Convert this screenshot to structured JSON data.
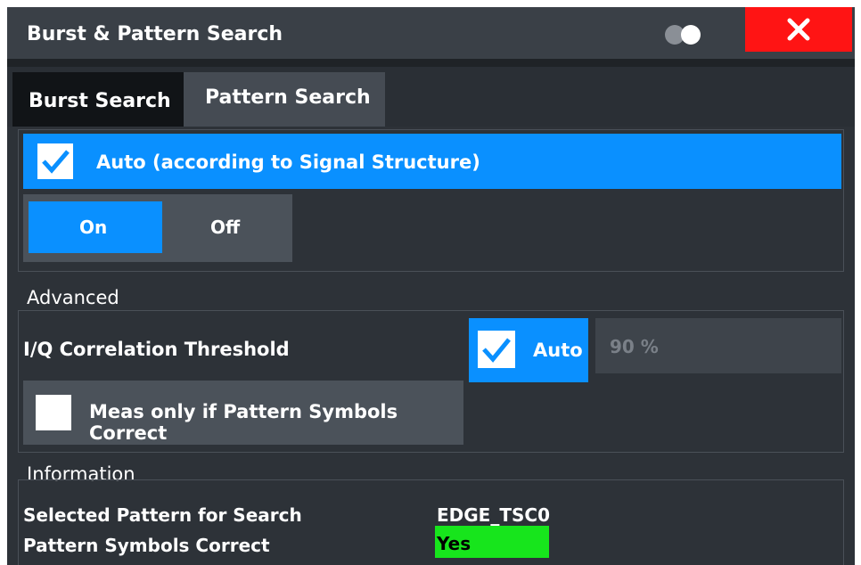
{
  "dialog": {
    "title": "Burst & Pattern Search",
    "icons": {
      "toggle": "toggle-icon",
      "close": "close-icon"
    },
    "accent_color": "#0a90ff",
    "close_color": "#ff1414"
  },
  "tabs": [
    {
      "label": "Burst Search",
      "active": false
    },
    {
      "label": "Pattern Search",
      "active": true
    }
  ],
  "auto_signal": {
    "label": "Auto (according to Signal Structure)",
    "checked": true
  },
  "on_off": {
    "on_label": "On",
    "off_label": "Off",
    "selected": "On"
  },
  "advanced": {
    "section_label": "Advanced",
    "iq_threshold_label": "I/Q Correlation Threshold",
    "auto_label": "Auto",
    "auto_checked": true,
    "threshold_value": "90 %",
    "meas_only_label": "Meas only if Pattern Symbols Correct",
    "meas_only_checked": false
  },
  "information": {
    "section_label": "Information",
    "rows": [
      {
        "label": "Selected Pattern for Search",
        "value": "EDGE_TSC0"
      },
      {
        "label": "Pattern Symbols Correct",
        "value": "Yes",
        "status_color": "#17e51c"
      }
    ]
  }
}
